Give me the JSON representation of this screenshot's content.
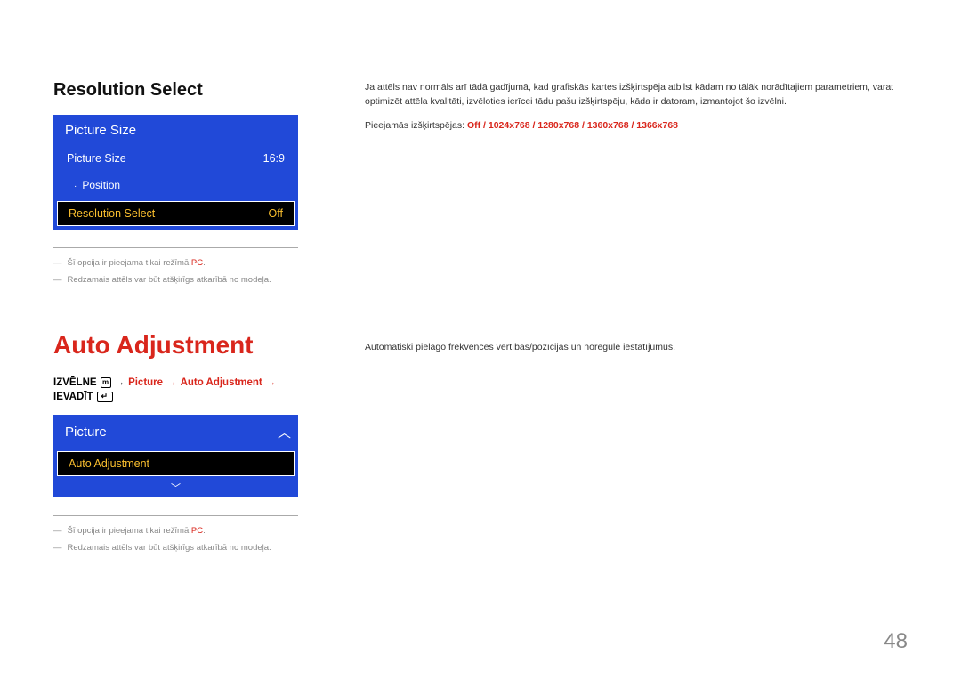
{
  "section1": {
    "title": "Resolution Select",
    "menu": {
      "header": "Picture Size",
      "row1": {
        "label": "Picture Size",
        "value": "16:9"
      },
      "row2": {
        "label": "Position"
      },
      "row3": {
        "label": "Resolution Select",
        "value": "Off"
      }
    },
    "footnotes": {
      "a_pre": "Šī opcija ir pieejama tikai režīmā ",
      "a_red": "PC",
      "a_post": ".",
      "b": "Redzamais attēls var būt atšķirīgs atkarībā no modeļa."
    },
    "desc1": "Ja attēls nav normāls arī tādā gadījumā, kad grafiskās kartes izšķirtspēja atbilst kādam no tālāk norādītajiem parametriem, varat optimizēt attēla kvalitāti, izvēloties ierīcei tādu pašu izšķirtspēju, kāda ir datoram, izmantojot šo izvēlni.",
    "desc2_pre": "Pieejamās izšķirtspējas: ",
    "desc2_vals": "Off / 1024x768 / 1280x768 / 1360x768 / 1366x768"
  },
  "section2": {
    "title": "Auto Adjustment",
    "breadcrumb": {
      "w1": "IZVĒLNE",
      "arr": "→",
      "p1": "Picture",
      "p2": "Auto Adjustment",
      "w2": "IEVADĪT"
    },
    "menu": {
      "header": "Picture",
      "row": "Auto Adjustment",
      "chev_up": "︿",
      "chev_down": "﹀"
    },
    "footnotes": {
      "a_pre": "Šī opcija ir pieejama tikai režīmā ",
      "a_red": "PC",
      "a_post": ".",
      "b": "Redzamais attēls var būt atšķirīgs atkarībā no modeļa."
    },
    "desc": "Automātiski pielāgo frekvences vērtības/pozīcijas un noregulē iestatījumus."
  },
  "page": "48"
}
